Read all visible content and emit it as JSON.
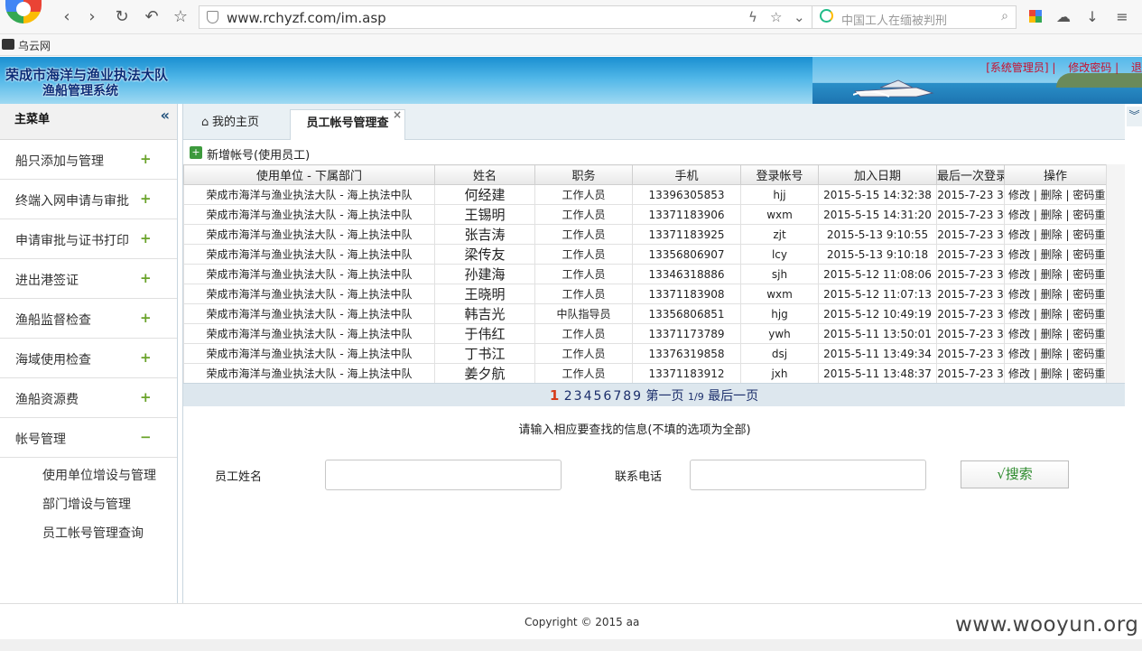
{
  "browser": {
    "url": "www.rchyzf.com/im.asp",
    "search_placeholder": "中国工人在缅被判刑",
    "bookmark_label": "乌云网"
  },
  "banner": {
    "title_line1": "荣成市海洋与渔业执法大队",
    "title_line2": "渔船管理系统",
    "user_label": "[系统管理员]",
    "change_password": "修改密码",
    "logout_partial": "退"
  },
  "sidebar": {
    "heading": "主菜单",
    "collapse_glyph": "«",
    "items": [
      {
        "label": "船只添加与管理",
        "toggle": "+"
      },
      {
        "label": "终端入网申请与审批",
        "toggle": "+"
      },
      {
        "label": "申请审批与证书打印",
        "toggle": "+"
      },
      {
        "label": "进出港签证",
        "toggle": "+"
      },
      {
        "label": "渔船监督检查",
        "toggle": "+"
      },
      {
        "label": "海域使用检查",
        "toggle": "+"
      },
      {
        "label": "渔船资源费",
        "toggle": "+"
      },
      {
        "label": "帐号管理",
        "toggle": "−"
      }
    ],
    "subitems": [
      "使用单位增设与管理",
      "部门增设与管理",
      "员工帐号管理查询"
    ]
  },
  "tabs": {
    "home": "我的主页",
    "active": "员工帐号管理查",
    "close_glyph": "×"
  },
  "toolbar": {
    "add_label": "新增帐号(使用员工)"
  },
  "table": {
    "headers": [
      "使用单位 - 下属部门",
      "姓名",
      "职务",
      "手机",
      "登录帐号",
      "加入日期",
      "最后一次登录",
      "操作"
    ],
    "rows": [
      [
        "荣成市海洋与渔业执法大队 - 海上执法中队",
        "何经建",
        "工作人员",
        "13396305853",
        "hjj",
        "2015-5-15 14:32:38",
        "2015-7-23 3",
        "修改 | 删除 | 密码重置"
      ],
      [
        "荣成市海洋与渔业执法大队 - 海上执法中队",
        "王锡明",
        "工作人员",
        "13371183906",
        "wxm",
        "2015-5-15 14:31:20",
        "2015-7-23 3",
        "修改 | 删除 | 密码重置"
      ],
      [
        "荣成市海洋与渔业执法大队 - 海上执法中队",
        "张吉涛",
        "工作人员",
        "13371183925",
        "zjt",
        "2015-5-13 9:10:55",
        "2015-7-23 3",
        "修改 | 删除 | 密码重置"
      ],
      [
        "荣成市海洋与渔业执法大队 - 海上执法中队",
        "梁传友",
        "工作人员",
        "13356806907",
        "lcy",
        "2015-5-13 9:10:18",
        "2015-7-23 3",
        "修改 | 删除 | 密码重置"
      ],
      [
        "荣成市海洋与渔业执法大队 - 海上执法中队",
        "孙建海",
        "工作人员",
        "13346318886",
        "sjh",
        "2015-5-12 11:08:06",
        "2015-7-23 3",
        "修改 | 删除 | 密码重置"
      ],
      [
        "荣成市海洋与渔业执法大队 - 海上执法中队",
        "王晓明",
        "工作人员",
        "13371183908",
        "wxm",
        "2015-5-12 11:07:13",
        "2015-7-23 3",
        "修改 | 删除 | 密码重置"
      ],
      [
        "荣成市海洋与渔业执法大队 - 海上执法中队",
        "韩吉光",
        "中队指导员",
        "13356806851",
        "hjg",
        "2015-5-12 10:49:19",
        "2015-7-23 3",
        "修改 | 删除 | 密码重置"
      ],
      [
        "荣成市海洋与渔业执法大队 - 海上执法中队",
        "于伟红",
        "工作人员",
        "13371173789",
        "ywh",
        "2015-5-11 13:50:01",
        "2015-7-23 3",
        "修改 | 删除 | 密码重置"
      ],
      [
        "荣成市海洋与渔业执法大队 - 海上执法中队",
        "丁书江",
        "工作人员",
        "13376319858",
        "dsj",
        "2015-5-11 13:49:34",
        "2015-7-23 3",
        "修改 | 删除 | 密码重置"
      ],
      [
        "荣成市海洋与渔业执法大队 - 海上执法中队",
        "姜夕航",
        "工作人员",
        "13371183912",
        "jxh",
        "2015-5-11 13:48:37",
        "2015-7-23 3",
        "修改 | 删除 | 密码重置"
      ]
    ]
  },
  "pager": {
    "current": "1",
    "pages": [
      "2",
      "3",
      "4",
      "5",
      "6",
      "7",
      "8",
      "9"
    ],
    "first": "第一页",
    "position": "1/9",
    "last": "最后一页"
  },
  "search": {
    "hint": "请输入相应要查找的信息(不填的选项为全部)",
    "name_label": "员工姓名",
    "name_value": "",
    "phone_label": "联系电话",
    "phone_value": "",
    "button_label": "√搜索"
  },
  "footer": {
    "copyright": "Copyright © 2015 aa",
    "watermark": "www.wooyun.org"
  }
}
